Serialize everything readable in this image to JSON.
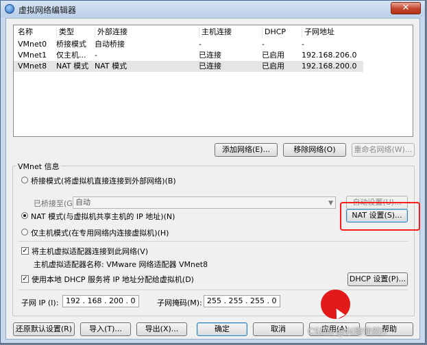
{
  "window": {
    "title": "虚拟网络编辑器",
    "close_glyph": "✕"
  },
  "table": {
    "columns": [
      "名称",
      "类型",
      "外部连接",
      "主机连接",
      "DHCP",
      "子网地址"
    ],
    "rows": [
      [
        "VMnet0",
        "桥接模式",
        "自动桥接",
        "-",
        "-",
        "-"
      ],
      [
        "VMnet1",
        "仅主机...",
        "-",
        "已连接",
        "已启用",
        "192.168.206.0"
      ],
      [
        "VMnet8",
        "NAT 模式",
        "NAT 模式",
        "已连接",
        "已启用",
        "192.168.200.0"
      ]
    ],
    "selected_row": 2
  },
  "list_buttons": {
    "add": "添加网络(E)...",
    "remove": "移除网络(O)",
    "rename": "重命名网络(W)..."
  },
  "vmnet_info": {
    "title": "VMnet 信息",
    "bridged_label": "桥接模式(将虚拟机直接连接到外部网络)(B)",
    "bridged_to_label": "已桥接至(G):",
    "bridged_to_value": "自动",
    "auto_settings": "自动设置(U)...",
    "nat_label": "NAT 模式(与虚拟机共享主机的 IP 地址)(N)",
    "nat_settings": "NAT 设置(S)...",
    "hostonly_label": "仅主机模式(在专用网络内连接虚拟机)(H)",
    "selected_mode": "nat",
    "connect_adapter_label": "将主机虚拟适配器连接到此网络(V)",
    "adapter_name_label": "主机虚拟适配器名称: VMware 网络适配器 VMnet8",
    "dhcp_label": "使用本地 DHCP 服务将 IP 地址分配给虚拟机(D)",
    "dhcp_settings": "DHCP 设置(P)...",
    "subnet_ip_label": "子网 IP (I):",
    "subnet_ip": "192 . 168 . 200 . 0",
    "subnet_mask_label": "子网掩码(M):",
    "subnet_mask": "255 . 255 . 255 . 0"
  },
  "footer_buttons": {
    "restore": "还原默认设置(R)",
    "import": "导入(T)...",
    "export": "导出(X)...",
    "ok": "确定",
    "cancel": "取消",
    "apply": "应用(A)",
    "help": "帮助"
  },
  "watermark": "CSDN @兴趣使然h",
  "colors": {
    "highlight": "#ff1a1a",
    "cursor_blob": "#e31a1a",
    "title_bar": "#c8d9ee"
  },
  "icons": [
    "globe-network-icon",
    "close-icon",
    "dropdown-arrow-icon",
    "mouse-cursor-icon"
  ]
}
